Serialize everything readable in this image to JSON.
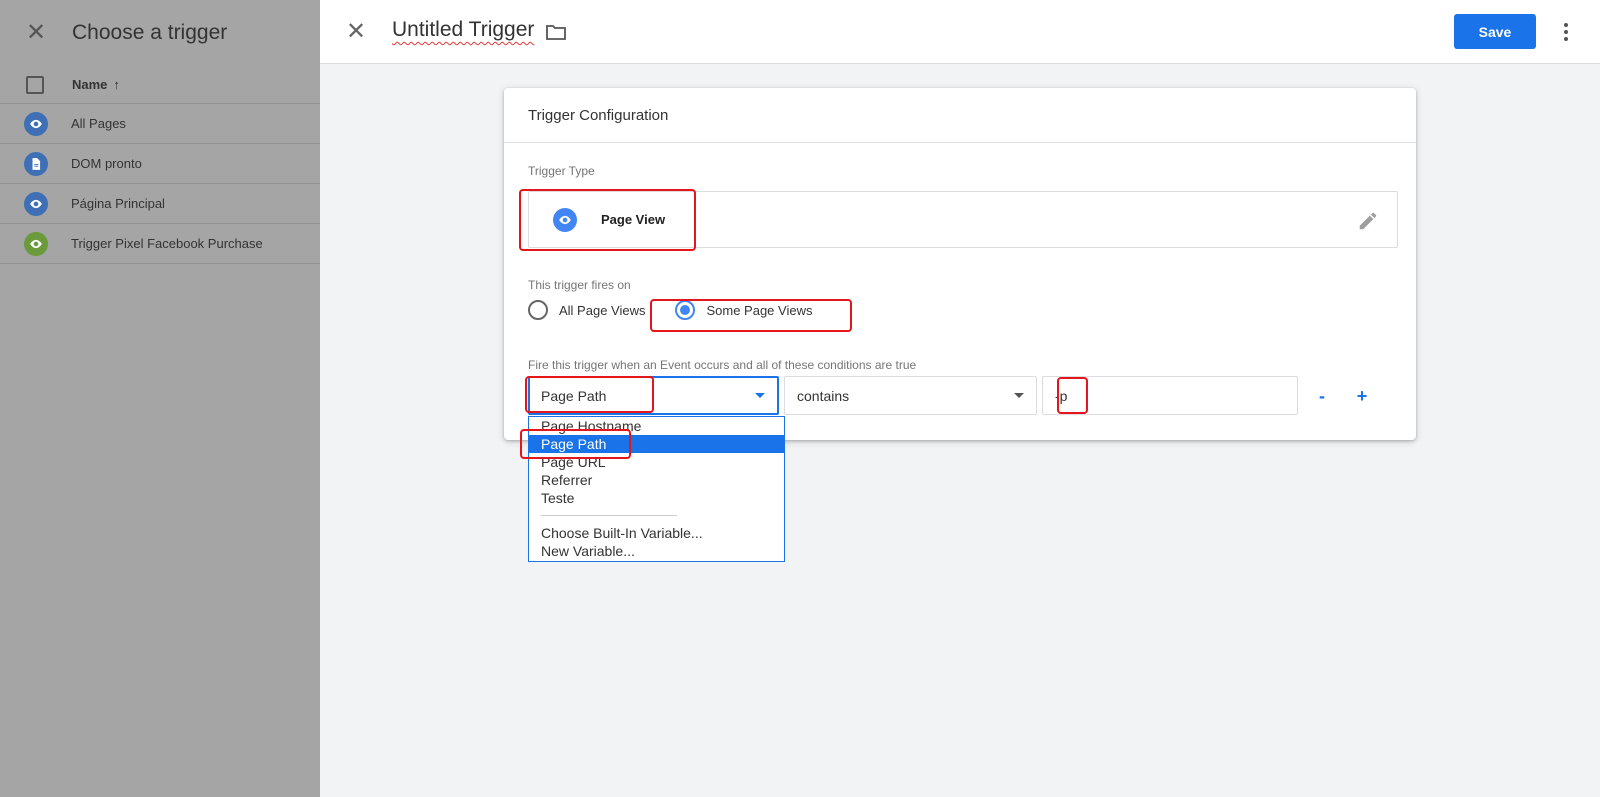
{
  "left_panel": {
    "title": "Choose a trigger",
    "column_name": "Name",
    "sort_indicator": "↑",
    "triggers": [
      {
        "label": "All Pages",
        "icon": "eye-icon",
        "color": "#3f6fb5"
      },
      {
        "label": "DOM pronto",
        "icon": "document-icon",
        "color": "#3f6fb5"
      },
      {
        "label": "Página Principal",
        "icon": "eye-icon",
        "color": "#3f6fb5"
      },
      {
        "label": "Trigger Pixel Facebook Purchase",
        "icon": "eye-icon",
        "color": "#6a9a3a"
      }
    ]
  },
  "editor": {
    "title": "Untitled Trigger",
    "save_label": "Save",
    "card_title": "Trigger Configuration",
    "trigger_type_label": "Trigger Type",
    "trigger_type_value": "Page View",
    "fires_on_label": "This trigger fires on",
    "fires_on_options": [
      "All Page Views",
      "Some Page Views"
    ],
    "fires_on_selected": "Some Page Views",
    "condition_label": "Fire this trigger when an Event occurs and all of these conditions are true",
    "condition": {
      "variable": "Page Path",
      "operator": "contains",
      "value": "-p"
    },
    "remove_label": "-",
    "add_label": "+"
  },
  "dropdown": {
    "items": [
      "Page Hostname",
      "Page Path",
      "Page URL",
      "Referrer",
      "Teste"
    ],
    "selected": "Page Path",
    "extra_items": [
      "Choose Built-In Variable...",
      "New Variable..."
    ]
  },
  "colors": {
    "accent": "#1a73e8",
    "annotation": "#e5161b"
  }
}
